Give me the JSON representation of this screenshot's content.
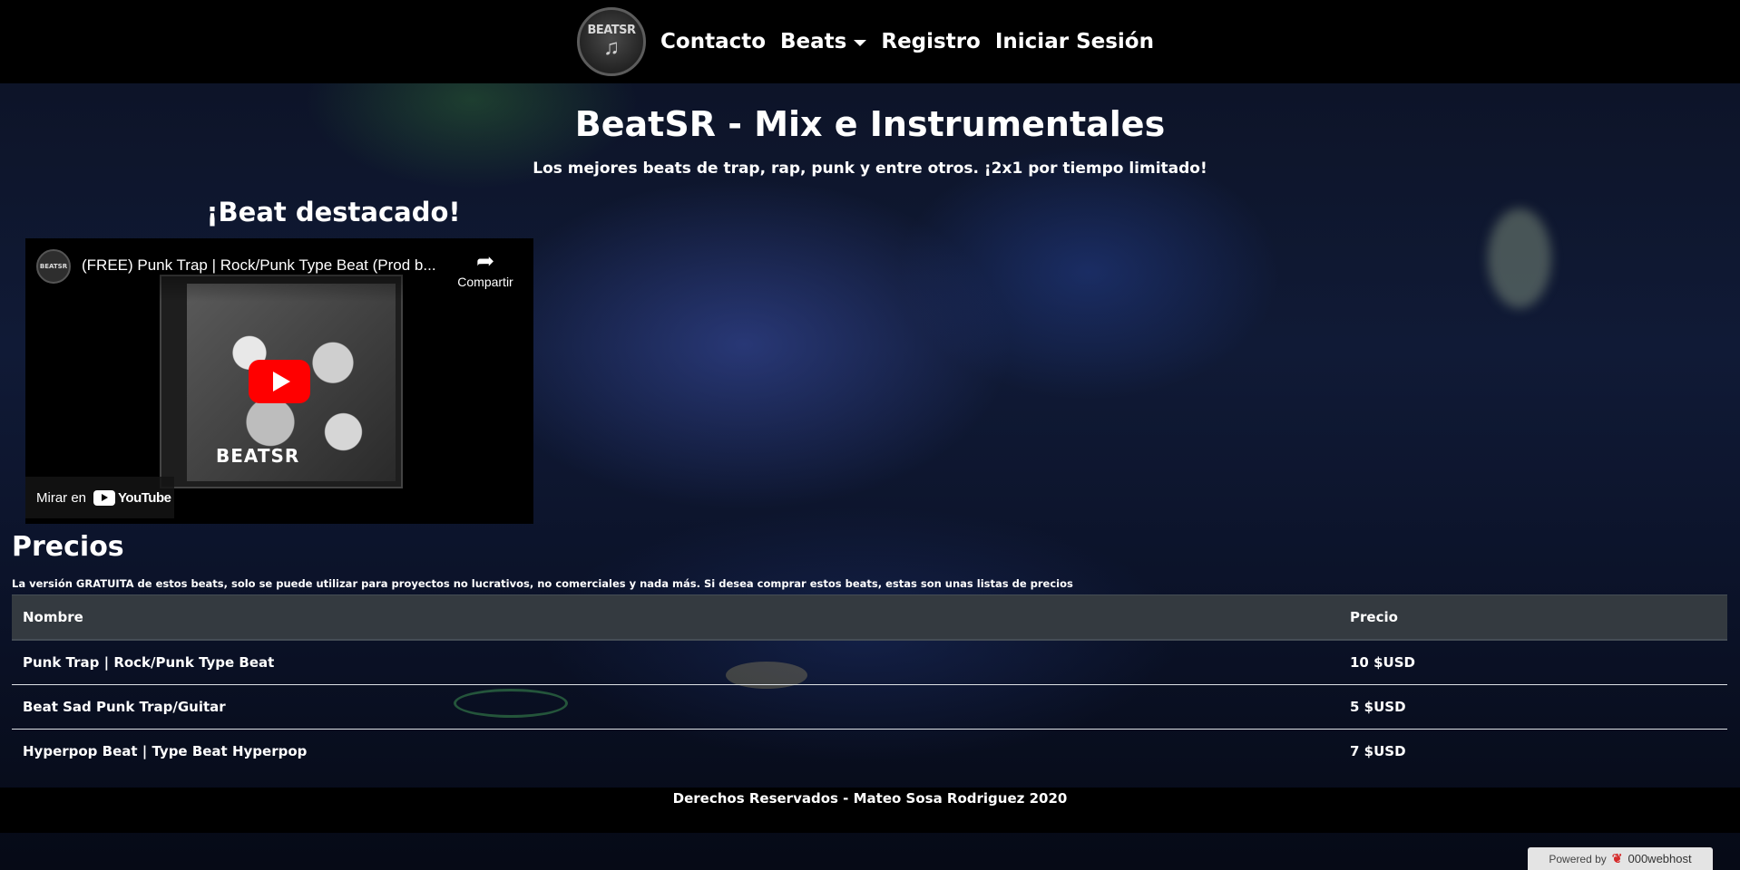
{
  "navbar": {
    "logo_text": "BEATSR",
    "logo_note": "♫",
    "links": [
      {
        "label": "Contacto"
      },
      {
        "label": "Beats"
      },
      {
        "label": "Registro"
      },
      {
        "label": "Iniciar Sesión"
      }
    ]
  },
  "header": {
    "title": "BeatSR - Mix e Instrumentales",
    "subtitle": "Los mejores beats de trap, rap, punk y entre otros. ¡2x1 por tiempo limitado!"
  },
  "featured": {
    "title": "¡Beat destacado!",
    "video": {
      "channel_avatar_text": "BEATSR",
      "title": "(FREE) Punk Trap | Rock/Punk Type Beat (Prod b...",
      "share_label": "Compartir",
      "album_label": "BEATSR",
      "watch_on_label": "Mirar en",
      "youtube_label": "YouTube"
    }
  },
  "prices": {
    "title": "Precios",
    "note": "La versión GRATUITA de estos beats, solo se puede utilizar para proyectos no lucrativos, no comerciales y nada más. Si desea comprar estos beats, estas son unas listas de precios",
    "headers": {
      "name": "Nombre",
      "price": "Precio"
    },
    "rows": [
      {
        "name": "Punk Trap | Rock/Punk Type Beat",
        "price": "10 $USD"
      },
      {
        "name": "Beat Sad Punk Trap/Guitar",
        "price": "5 $USD"
      },
      {
        "name": "Hyperpop Beat | Type Beat Hyperpop",
        "price": "7 $USD"
      }
    ]
  },
  "footer": {
    "text": "Derechos Reservados - Mateo Sosa Rodriguez 2020"
  },
  "powered_by": {
    "label": "Powered by",
    "brand": "000webhost"
  },
  "colors": {
    "navbar_bg": "#000000",
    "table_header_bg": "#343a40",
    "youtube_red": "#ff0000"
  }
}
